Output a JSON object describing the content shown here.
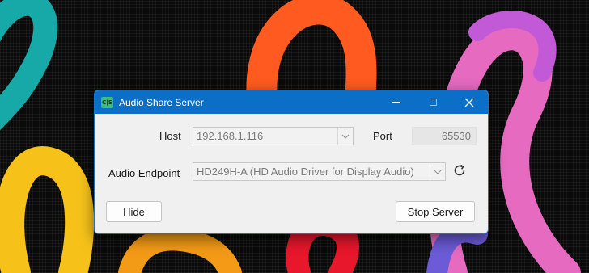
{
  "window": {
    "title": "Audio Share Server",
    "icon_label": "C|S"
  },
  "form": {
    "host_label": "Host",
    "host_value": "192.168.1.116",
    "port_label": "Port",
    "port_value": "65530",
    "endpoint_label": "Audio Endpoint",
    "endpoint_value": "HD249H-A (HD Audio Driver for Display Audio)"
  },
  "buttons": {
    "hide": "Hide",
    "stop_server": "Stop Server"
  },
  "icons": {
    "app": "audio-share-app-icon",
    "minimize": "minimize-icon",
    "maximize": "maximize-icon",
    "close": "close-icon",
    "dropdown": "chevron-down-icon",
    "refresh": "refresh-icon"
  },
  "colors": {
    "titlebar": "#0b6fc8",
    "window_bg": "#f0f0f0",
    "app_icon": "#3bbf78"
  }
}
